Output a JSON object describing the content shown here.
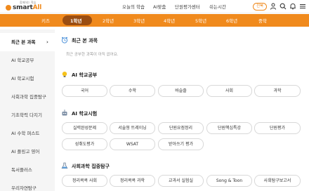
{
  "brand": {
    "tag": "함께하는 학습",
    "name_prefix": "smart",
    "name_suffix": "All"
  },
  "top_nav": [
    "오늘의 학습",
    "AI맞춤",
    "단원평가센터",
    "쉬는시간"
  ],
  "login_label": "전북",
  "grades": {
    "items": [
      "키즈",
      "1학년",
      "2학년",
      "3학년",
      "4학년",
      "5학년",
      "6학년",
      "중학"
    ],
    "active_index": 1
  },
  "sidebar": {
    "items": [
      {
        "label": "최근 본 과목",
        "active": true
      },
      {
        "label": "AI 학교공부",
        "active": false
      },
      {
        "label": "AI 학교시험",
        "active": false
      },
      {
        "label": "사회과학 집중탐구",
        "active": false
      },
      {
        "label": "기초학력 다지기",
        "active": false
      },
      {
        "label": "AI 수학 퍼스트",
        "active": false
      },
      {
        "label": "AI 플링고 영어",
        "active": false
      },
      {
        "label": "독서플러스",
        "active": false
      },
      {
        "label": "우리자연탐구",
        "active": false
      }
    ]
  },
  "main": {
    "recent": {
      "title": "최근 본 과목",
      "empty_message": "최근 공부한 과목이 아직 없어요."
    },
    "school_study": {
      "title": "AI 학교공부",
      "chips": [
        "국어",
        "수학",
        "바슬즐",
        "사회",
        "과학"
      ]
    },
    "school_test": {
      "title": "AI 학교시험",
      "chips": [
        "실력완성문제",
        "서술형 트레이닝",
        "단원요점정리",
        "단원핵심특강",
        "단원평가",
        "성취도평가",
        "WSAT",
        "받아쓰기 평가"
      ]
    },
    "social_science": {
      "title": "사회과학 집중탐구",
      "chips": [
        "정리콕콕 사회",
        "정리콕콕 과학",
        "교과서 실험실",
        "Song & Toon",
        "사회탐구보고서"
      ]
    }
  },
  "colors": {
    "accent": "#f08a1d",
    "active_grade_bg": "#9b4e12",
    "sidebar_bg": "#f5f5f5"
  }
}
